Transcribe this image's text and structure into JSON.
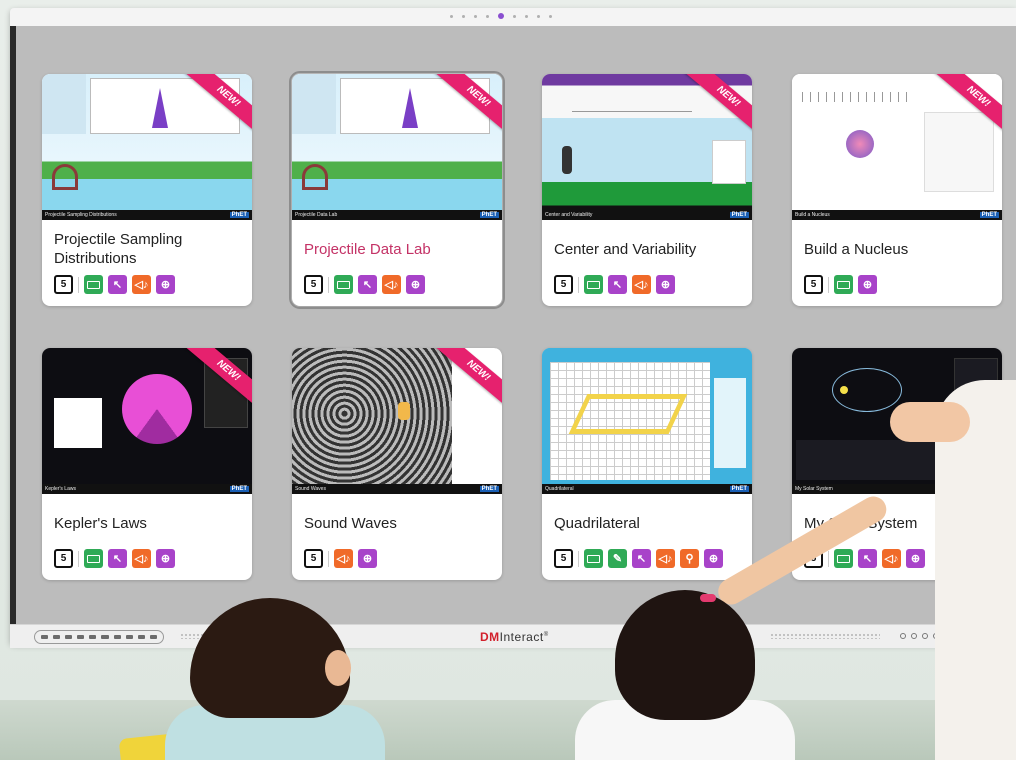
{
  "board": {
    "brand_prefix": "DM",
    "brand_name": "Interact",
    "brand_mark": "®",
    "pages": 9,
    "active_page": 4
  },
  "cards": [
    {
      "title": "Projectile Sampling Distributions",
      "new": true,
      "ribbon": "NEW!",
      "bar_title": "Projectile Sampling Distributions",
      "icons": [
        "html5-icon",
        "keyboard-icon",
        "pointer-icon",
        "sound-icon",
        "zoom-icon"
      ],
      "thumb_theme": "sky"
    },
    {
      "title": "Projectile Data Lab",
      "new": true,
      "ribbon": "NEW!",
      "bar_title": "Projectile Data Lab",
      "selected": true,
      "icons": [
        "html5-icon",
        "keyboard-icon",
        "pointer-icon",
        "sound-icon",
        "zoom-icon"
      ],
      "thumb_theme": "sky"
    },
    {
      "title": "Center and Variability",
      "new": true,
      "ribbon": "NEW!",
      "bar_title": "Center and Variability",
      "icons": [
        "html5-icon",
        "keyboard-icon",
        "pointer-icon",
        "sound-icon",
        "zoom-icon"
      ],
      "thumb_theme": "field"
    },
    {
      "title": "Build a Nucleus",
      "new": true,
      "ribbon": "NEW!",
      "bar_title": "Build a Nucleus",
      "icons": [
        "html5-icon",
        "keyboard-icon",
        "zoom-icon"
      ],
      "thumb_theme": "white"
    },
    {
      "title": "Kepler's Laws",
      "new": true,
      "ribbon": "NEW!",
      "bar_title": "Kepler's Laws",
      "icons": [
        "html5-icon",
        "keyboard-icon",
        "pointer-icon",
        "sound-icon",
        "zoom-icon"
      ],
      "thumb_theme": "space"
    },
    {
      "title": "Sound Waves",
      "new": true,
      "ribbon": "NEW!",
      "bar_title": "Sound Waves",
      "icons": [
        "html5-icon",
        "sound-icon",
        "zoom-icon"
      ],
      "thumb_theme": "waves"
    },
    {
      "title": "Quadrilateral",
      "new": false,
      "bar_title": "Quadrilateral",
      "icons": [
        "html5-icon",
        "keyboard-icon",
        "draw-icon",
        "pointer-icon",
        "sound-icon",
        "voice-icon",
        "zoom-icon"
      ],
      "thumb_theme": "grid"
    },
    {
      "title": "My Solar System",
      "new": false,
      "bar_title": "My Solar System",
      "icons": [
        "html5-icon",
        "keyboard-icon",
        "pointer-icon",
        "sound-icon",
        "zoom-icon"
      ],
      "thumb_theme": "space"
    }
  ],
  "colors": {
    "ribbon": "#e6216e",
    "selected_title": "#c43266",
    "keyboard": "#2faa56",
    "pointer": "#a843c9",
    "sound": "#f06a29",
    "phet_logo": "#1a5fb4"
  }
}
